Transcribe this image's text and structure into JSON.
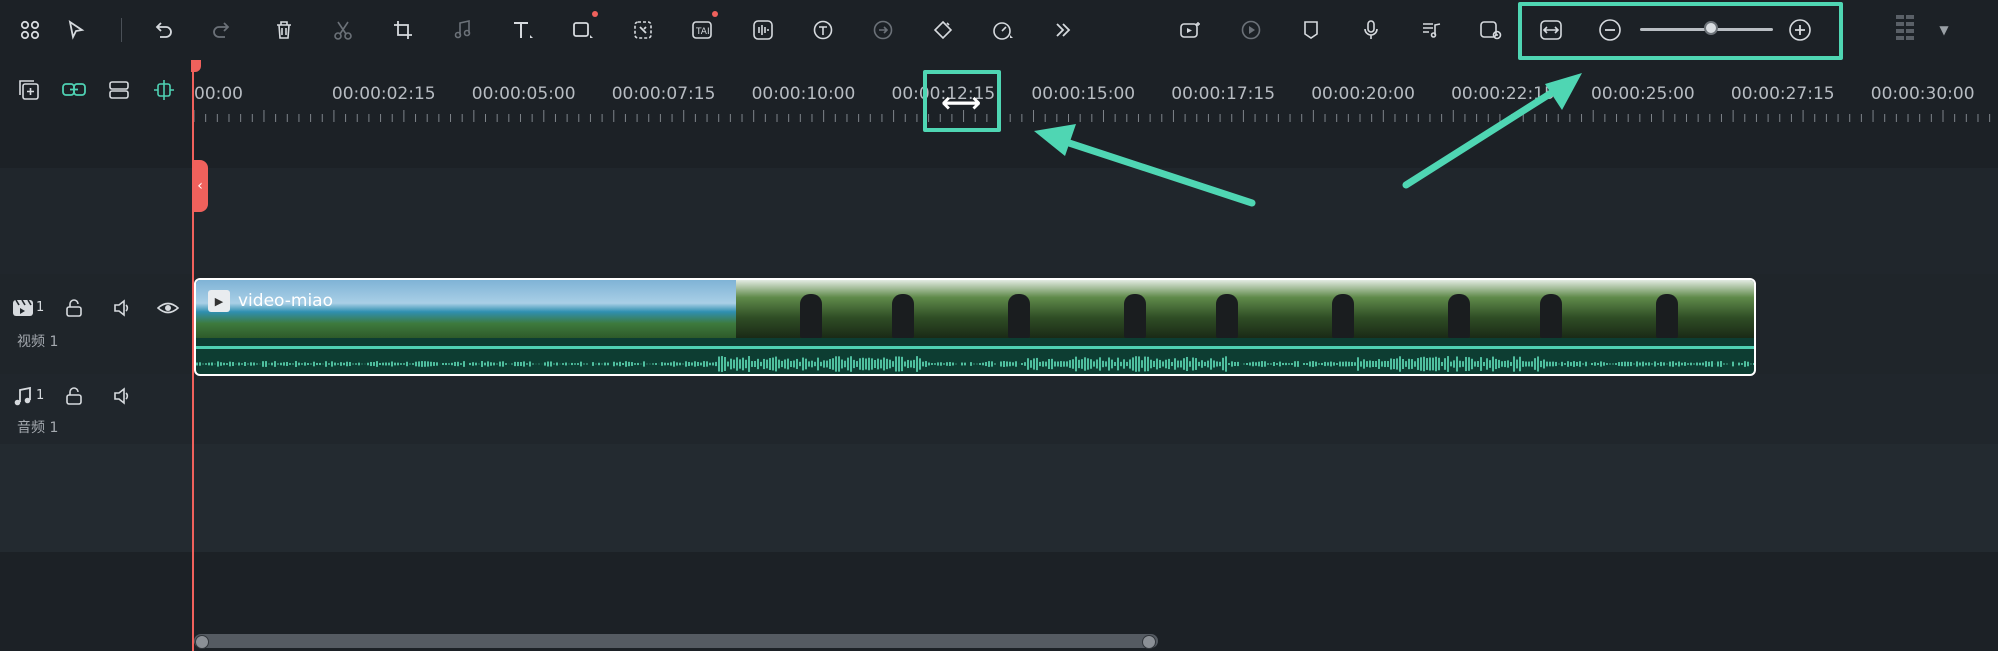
{
  "toolbar": {
    "left_icons": [
      "grid-icon",
      "select-arrow-icon",
      "undo-icon",
      "redo-icon",
      "delete-icon",
      "cut-icon",
      "crop-icon",
      "audio-edit-icon",
      "text-icon",
      "shape-icon",
      "ai-mask-icon",
      "ai-text-icon",
      "voice-icon",
      "speech-to-text-icon",
      "audio-stretch-icon",
      "keyframe-icon",
      "speed-icon",
      "more-chevrons-icon"
    ],
    "right_icons": [
      "ai-video-icon",
      "render-preview-icon",
      "marker-icon",
      "microphone-icon",
      "audio-ducking-icon",
      "snapshot-icon",
      "fit-timeline-icon",
      "zoom-out-icon",
      "zoom-in-icon",
      "layout-menu-icon"
    ],
    "zoom_level": 0.55
  },
  "timeline_tools": [
    "add-track-icon",
    "link-icon",
    "track-manager-icon",
    "auto-ripple-icon"
  ],
  "ruler": {
    "labels": [
      "00:00",
      "00:00:02:15",
      "00:00:05:00",
      "00:00:07:15",
      "00:00:10:00",
      "00:00:12:15",
      "00:00:15:00",
      "00:00:17:15",
      "00:00:20:00",
      "00:00:22:15",
      "00:00:25:00",
      "00:00:27:15",
      "00:00:30:00"
    ]
  },
  "tracks": {
    "video": {
      "number": "1",
      "label": "视频 1"
    },
    "audio": {
      "number": "1",
      "label": "音频 1"
    }
  },
  "clip": {
    "title": "video-miao"
  },
  "colors": {
    "highlight": "#4fd6b3",
    "playhead": "#f0615c",
    "accent": "#4fd1b3",
    "background": "#1c2126"
  }
}
